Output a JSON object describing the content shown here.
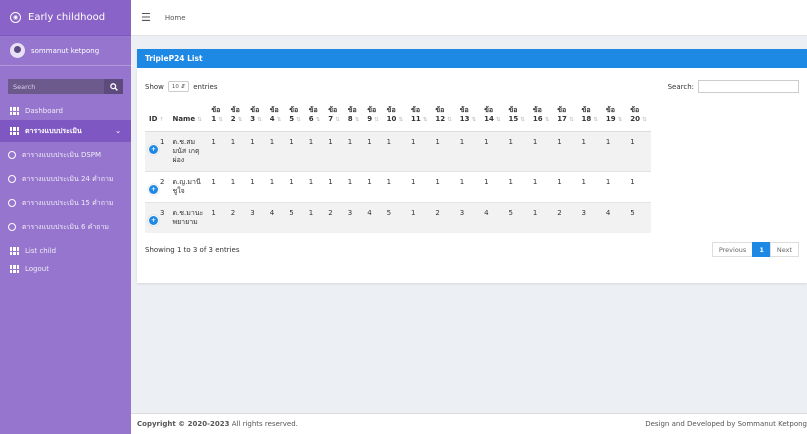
{
  "sidebar": {
    "brand": "Early childhood",
    "user": "sommanut ketpong",
    "search_placeholder": "Search",
    "items": [
      {
        "label": "Dashboard",
        "icon": "grid-icon"
      },
      {
        "label": "ตารางแบบประเมิน",
        "icon": "grid-icon",
        "active": true
      },
      {
        "label": "ตารางแบบประเมิน DSPM",
        "icon": "circle-icon"
      },
      {
        "label": "ตารางแบบประเมิน 24 คำถาม",
        "icon": "circle-icon"
      },
      {
        "label": "ตารางแบบประเมิน 15 คำถาม",
        "icon": "circle-icon"
      },
      {
        "label": "ตารางแบบประเมิน 6 คำถาม",
        "icon": "circle-icon"
      },
      {
        "label": "List child",
        "icon": "grid-icon"
      },
      {
        "label": "Logout",
        "icon": "grid-icon"
      }
    ]
  },
  "topbar": {
    "home": "Home"
  },
  "card": {
    "title": "TripleP24 List",
    "show_label": "Show",
    "show_value": "10",
    "entries_label": "entries",
    "search_label": "Search:",
    "headers": [
      "ID",
      "Name",
      "ข้อ 1",
      "ข้อ 2",
      "ข้อ 3",
      "ข้อ 4",
      "ข้อ 5",
      "ข้อ 6",
      "ข้อ 7",
      "ข้อ 8",
      "ข้อ 9",
      "ข้อ 10",
      "ข้อ 11",
      "ข้อ 12",
      "ข้อ 13",
      "ข้อ 14",
      "ข้อ 15",
      "ข้อ 16",
      "ข้อ 17",
      "ข้อ 18",
      "ข้อ 19",
      "ข้อ 20"
    ],
    "rows": [
      {
        "id": "1",
        "name": [
          "ด.ช.สม",
          "มนัส เกตุ",
          "ผ่อง"
        ],
        "values": [
          "1",
          "1",
          "1",
          "1",
          "1",
          "1",
          "1",
          "1",
          "1",
          "1",
          "1",
          "1",
          "1",
          "1",
          "1",
          "1",
          "1",
          "1",
          "1",
          "1"
        ]
      },
      {
        "id": "2",
        "name": [
          "ด.ญ.มานี",
          "ชูใจ"
        ],
        "values": [
          "1",
          "1",
          "1",
          "1",
          "1",
          "1",
          "1",
          "1",
          "1",
          "1",
          "1",
          "1",
          "1",
          "1",
          "1",
          "1",
          "1",
          "1",
          "1",
          "1"
        ]
      },
      {
        "id": "3",
        "name": [
          "ด.ช.มานะ",
          "พยายาม"
        ],
        "values": [
          "1",
          "2",
          "3",
          "4",
          "5",
          "1",
          "2",
          "3",
          "4",
          "5",
          "1",
          "2",
          "3",
          "4",
          "5",
          "1",
          "2",
          "3",
          "4",
          "5"
        ]
      }
    ],
    "info": "Showing 1 to 3 of 3 entries",
    "pager": {
      "prev": "Previous",
      "current": "1",
      "next": "Next"
    }
  },
  "footer": {
    "copyright_bold": "Copyright © 2020-2023",
    "copyright_rest": " All rights reserved.",
    "credit": "Design and Developed by Sommanut Ketpong"
  },
  "colors": {
    "sidebar": "#9575cd",
    "accent": "#1e88e5"
  }
}
